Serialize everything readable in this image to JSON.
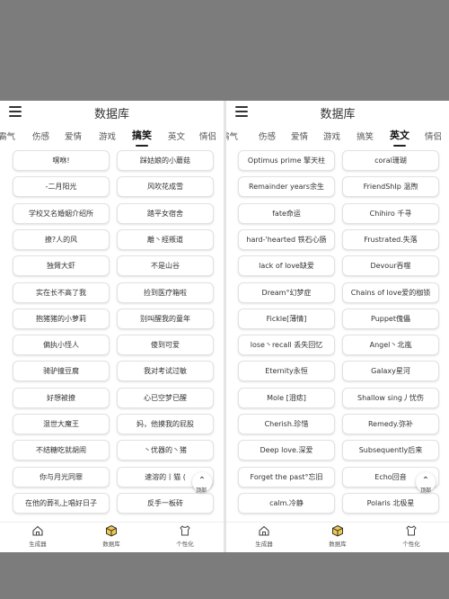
{
  "left": {
    "title": "数据库",
    "tabs": [
      "霸气",
      "伤感",
      "爱情",
      "游戏",
      "搞笑",
      "英文",
      "情侣"
    ],
    "active_tab": 4,
    "items": [
      "嘿咻!",
      "踩姑娘的小蘑菇",
      "-二月阳光",
      "风吹花成雪",
      "学校又名婚姻介绍所",
      "踏平女宿舍",
      "撩?人的风",
      "離丶經叛道",
      "独臂大虾",
      "不是山谷",
      "实在长不高了我",
      "捡到医疗箱啦",
      "抱猪猪的小萝莉",
      "别叫醒我的童年",
      "偏执小怪人",
      "傻到可爱",
      "骑驴撞豆腐",
      "我对考试过敏",
      "好想被撩",
      "心已空梦已醒",
      "混世大魔王",
      "妈，他摸我的屁股",
      "不结糖吃就胡闹",
      "丶优器的丶猪",
      "你与月光同罪",
      "速溶的丨猫 (",
      "在他的葬礼上唱好日子",
      "反手一板砖"
    ],
    "back_to_top": "顶部",
    "nav": [
      "生成器",
      "数据库",
      "个性化"
    ]
  },
  "right": {
    "title": "数据库",
    "tabs": [
      "霸气",
      "伤感",
      "爱情",
      "游戏",
      "搞笑",
      "英文",
      "情侣"
    ],
    "active_tab": 5,
    "items": [
      "Optimus prime 擎天柱",
      "coral珊瑚",
      "Remainder years余生",
      "FriendShIp 温煦",
      "fate命运",
      "Chihiro 千寻",
      "hard-'hearted 铁石心肠",
      "Frustrated.失落",
      "lack of love缺爱",
      "Devour吞噬",
      "Dream°幻梦症",
      "Chains of love爱的枷锁",
      "Fickle[薄情]",
      "Puppet傀儡",
      "lose丶recall 丢失回忆",
      "Angel丶北嵐",
      "Eternity永恒",
      "Galaxy星河",
      "Mole [泪痣]",
      "Shallow sing丿忧伤",
      "Cherish.珍惜",
      "Remedy.弥补",
      "Deep love.深爱",
      "Subsequently后来",
      "Forget the past°忘旧",
      "Echo回音",
      "calm.冷静",
      "Polaris 北极星"
    ],
    "back_to_top": "顶部",
    "nav": [
      "生成器",
      "数据库",
      "个性化"
    ]
  }
}
